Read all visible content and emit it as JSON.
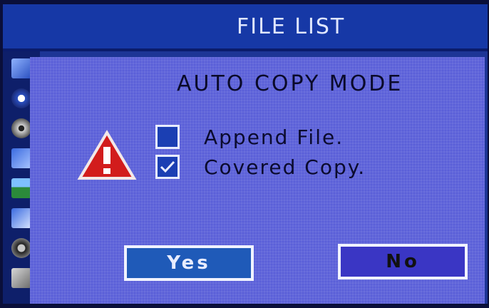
{
  "header": {
    "title": "FILE LIST"
  },
  "dialog": {
    "heading": "AUTO COPY MODE",
    "options": [
      {
        "label": "Append File.",
        "checked": false
      },
      {
        "label": "Covered Copy.",
        "checked": true
      }
    ],
    "buttons": {
      "yes": "Yes",
      "no": "No"
    },
    "warning_icon": "warning-triangle-exclamation"
  },
  "sidebar": {
    "icons": [
      "tv-icon",
      "video-icon",
      "film-reel-icon",
      "movie-icon",
      "photo-icon",
      "picture-icon",
      "speaker-icon",
      "edit-icon"
    ]
  },
  "colors": {
    "title_bar": "#1638a6",
    "panel": "#5a5fd8",
    "button_yes": "#1f5ab8",
    "button_no": "#3a36c4",
    "warning": "#d21c1c"
  }
}
